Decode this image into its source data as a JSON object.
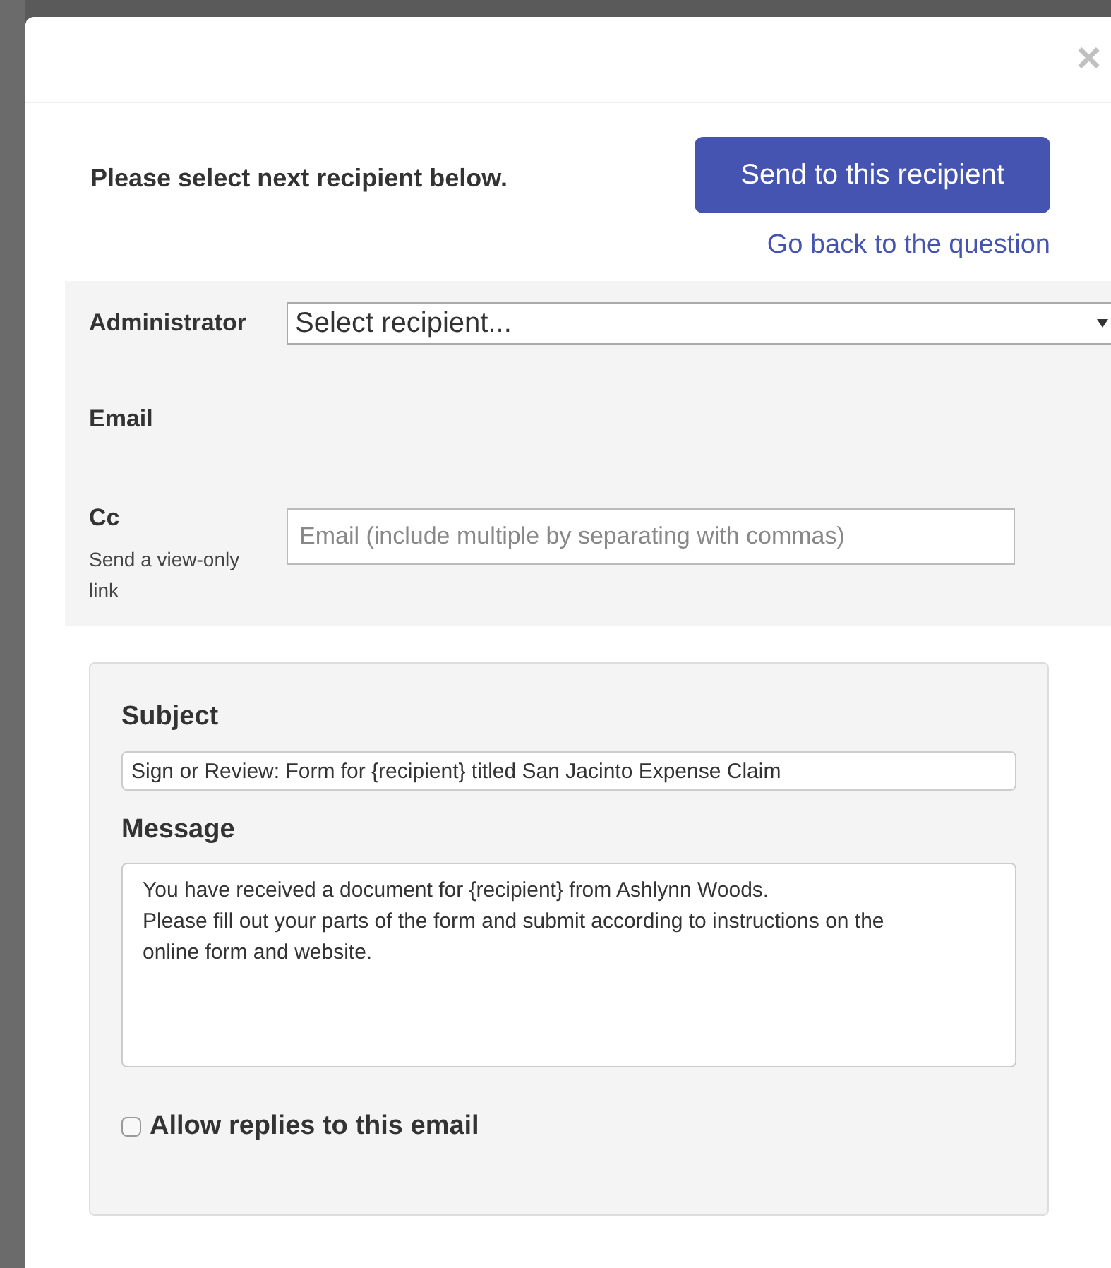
{
  "dialog": {
    "close_icon": "×",
    "prompt": "Please select next recipient below.",
    "send_button": "Send to this recipient",
    "back_link": "Go back to the question"
  },
  "recipient": {
    "role_label": "Administrator",
    "select_value": "Select recipient...",
    "email_label": "Email",
    "cc_label": "Cc",
    "cc_hint": "Send a view-only link",
    "cc_placeholder": "Email (include multiple by separating with commas)"
  },
  "message": {
    "subject_label": "Subject",
    "subject_value": "Sign or Review: Form for {recipient} titled San Jacinto Expense Claim",
    "message_label": "Message",
    "message_value": "You have received a document for {recipient} from Ashlynn Woods.\nPlease fill out your parts of the form and submit according to instructions on the online form and website.",
    "allow_replies": {
      "label": "Allow replies to this email",
      "checked": false
    }
  }
}
